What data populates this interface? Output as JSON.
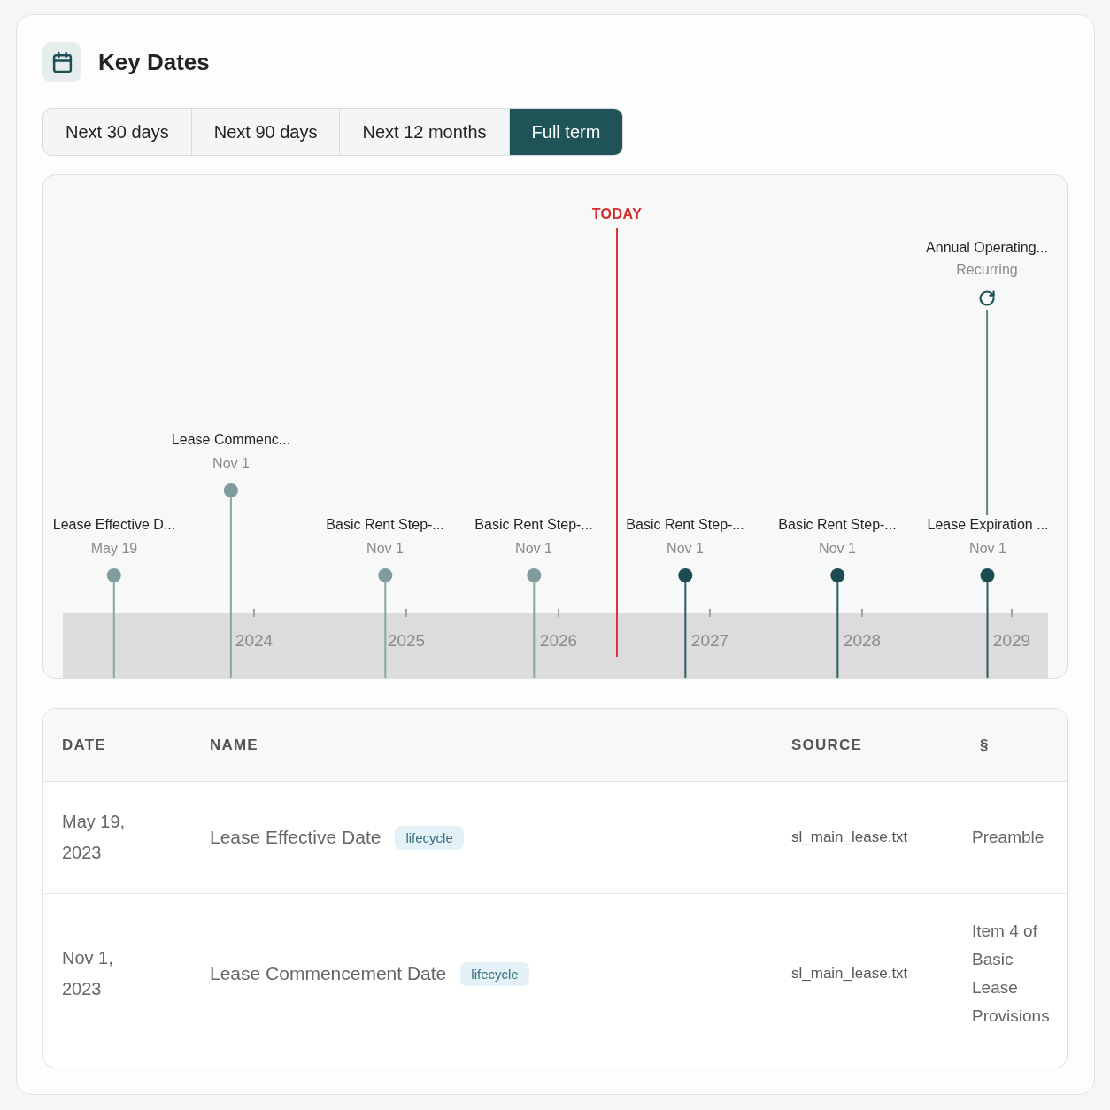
{
  "header": {
    "title": "Key Dates"
  },
  "tabs": [
    {
      "label": "Next 30 days",
      "selected": false
    },
    {
      "label": "Next 90 days",
      "selected": false
    },
    {
      "label": "Next 12 months",
      "selected": false
    },
    {
      "label": "Full term",
      "selected": true
    }
  ],
  "timeline": {
    "today": {
      "label": "TODAY"
    },
    "events": [
      {
        "kind": "recurring",
        "title": "Annual Operating...",
        "note": "Recurring"
      },
      {
        "kind": "date",
        "title": "Lease Commenc...",
        "date": "Nov 1",
        "past": true
      },
      {
        "kind": "date",
        "title": "Lease Effective D...",
        "date": "May 19",
        "past": true
      },
      {
        "kind": "date",
        "title": "Basic Rent Step-...",
        "date": "Nov 1",
        "past": true
      },
      {
        "kind": "date",
        "title": "Basic Rent Step-...",
        "date": "Nov 1",
        "past": true
      },
      {
        "kind": "date",
        "title": "Basic Rent Step-...",
        "date": "Nov 1",
        "past": false
      },
      {
        "kind": "date",
        "title": "Basic Rent Step-...",
        "date": "Nov 1",
        "past": false
      },
      {
        "kind": "date",
        "title": "Lease Expiration ...",
        "date": "Nov 1",
        "past": false
      }
    ],
    "axis_labels": [
      "2024",
      "2025",
      "2026",
      "2027",
      "2028",
      "2029"
    ]
  },
  "table": {
    "columns": [
      "DATE",
      "NAME",
      "SOURCE",
      "§"
    ],
    "rows": [
      {
        "date": "May 19, 2023",
        "name": "Lease Effective Date",
        "tag": "lifecycle",
        "source": "sl_main_lease.txt",
        "section": "Preamble"
      },
      {
        "date": "Nov 1, 2023",
        "name": "Lease Commencement Date",
        "tag": "lifecycle",
        "source": "sl_main_lease.txt",
        "section": "Item 4 of Basic Lease Provisions"
      }
    ]
  }
}
